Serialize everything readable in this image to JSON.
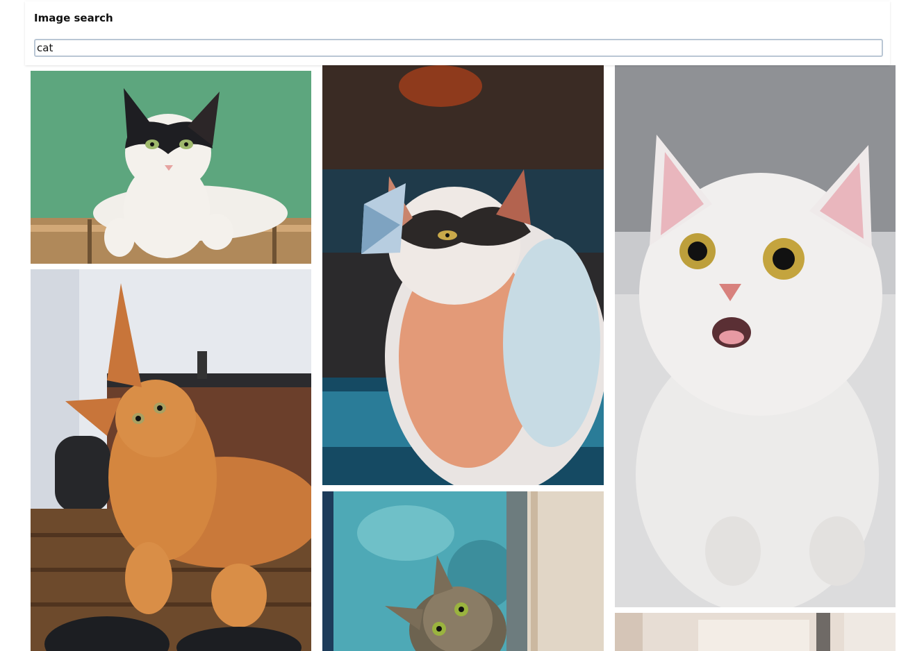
{
  "header": {
    "title": "Image search"
  },
  "search": {
    "value": "cat"
  },
  "results": [
    {
      "name": "cat-photo-black-white-green-wall"
    },
    {
      "name": "cat-photo-orange-maine-coon"
    },
    {
      "name": "cat-photo-calico-butterfly"
    },
    {
      "name": "cat-photo-tabby-peeking"
    },
    {
      "name": "cat-photo-white-kitten-surprised"
    },
    {
      "name": "cat-photo-partial-room"
    }
  ]
}
